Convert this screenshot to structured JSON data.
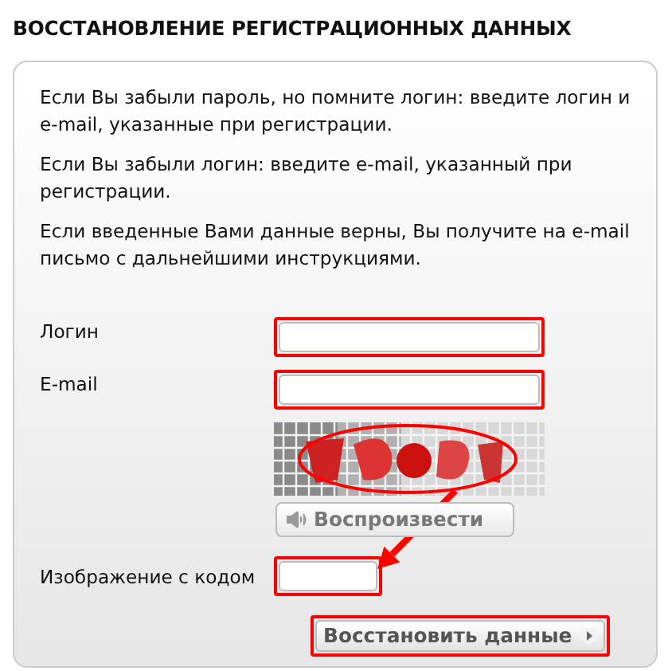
{
  "heading": "ВОССТАНОВЛЕНИЕ РЕГИСТРАЦИОННЫХ ДАННЫХ",
  "paragraphs": [
    "Если Вы забыли пароль, но помните логин: введите логин и e-mail, указанные при регистрации.",
    "Если Вы забыли логин: введите e-mail, указанный при регистрации.",
    "Если введенные Вами данные верны, Вы получите на e-mail письмо с дальнейшими инструкциями."
  ],
  "fields": [
    {
      "label": "Логин",
      "highlighted": true
    },
    {
      "label": "E-mail",
      "highlighted": true
    }
  ],
  "captcha": {
    "kind": "picture",
    "circled": true,
    "arrow_to_code": true
  },
  "play_button": {
    "label": "Воспроизвести"
  },
  "code_field": {
    "label": "Изображение с кодом",
    "highlighted": true
  },
  "submit_button": {
    "label": "Восстановить данные",
    "highlighted": true
  }
}
